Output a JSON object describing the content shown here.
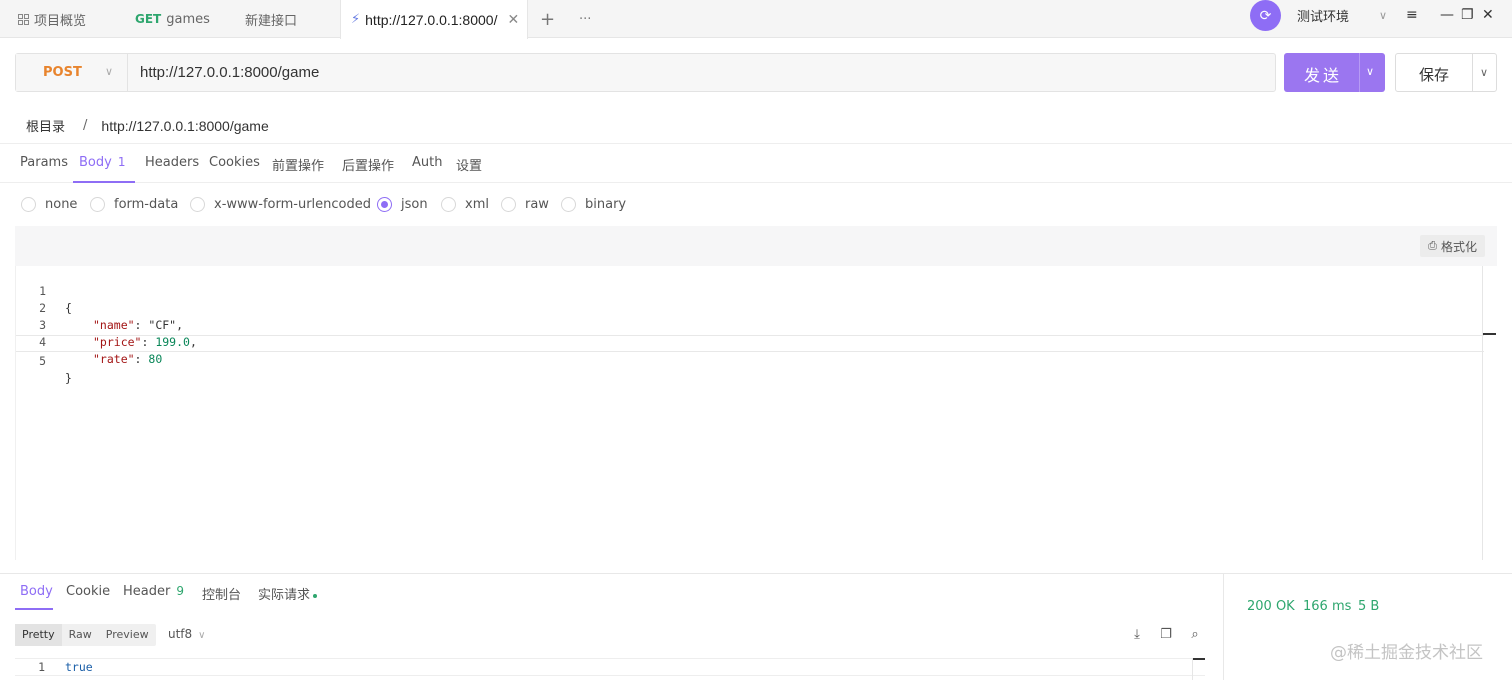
{
  "tabs": {
    "overview": "项目概览",
    "get_method": "GET",
    "get_label": "games",
    "new_api": "新建接口",
    "active_label": "http://127.0.0.1:8000/",
    "close_glyph": "✕",
    "plus_glyph": "+",
    "more_glyph": "···"
  },
  "env": {
    "name": "测试环境",
    "icon": "refresh-icon",
    "accent": "#8e6df5"
  },
  "window": {
    "menu": "≡",
    "minimize": "—",
    "restore": "❐",
    "close": "✕"
  },
  "request": {
    "method": "POST",
    "method_color": "#e8842d",
    "url": "http://127.0.0.1:8000/game",
    "send_label": "发送",
    "save_label": "保存"
  },
  "breadcrumb": {
    "root": "根目录",
    "sep": "/",
    "current": "http://127.0.0.1:8000/game"
  },
  "request_tabs": {
    "params": "Params",
    "body": "Body",
    "body_count": "1",
    "headers": "Headers",
    "cookies": "Cookies",
    "pre": "前置操作",
    "post": "后置操作",
    "auth": "Auth",
    "settings": "设置"
  },
  "body_types": {
    "none": "none",
    "form_data": "form-data",
    "urlencoded": "x-www-form-urlencoded",
    "json": "json",
    "xml": "xml",
    "raw": "raw",
    "binary": "binary",
    "selected": "json"
  },
  "editor": {
    "format_label": "格式化",
    "line_numbers": [
      "1",
      "2",
      "3",
      "4",
      "5"
    ],
    "l1": "{",
    "l2_key": "\"name\"",
    "l2_rest": ": \"CF\",",
    "l3_key": "\"price\"",
    "l3_colon": ": ",
    "l3_val": "199.0",
    "l3_comma": ",",
    "l4_key": "\"rate\"",
    "l4_colon": ": ",
    "l4_val": "80",
    "l5": "}"
  },
  "response_tabs": {
    "body": "Body",
    "cookie": "Cookie",
    "header": "Header",
    "header_count": "9",
    "console": "控制台",
    "actual": "实际请求"
  },
  "response_view": {
    "pretty": "Pretty",
    "raw": "Raw",
    "preview": "Preview",
    "encoding": "utf8",
    "line": "1",
    "content": "true"
  },
  "status": {
    "code": "200 OK",
    "time": "166 ms",
    "size": "5 B",
    "color": "#2ea66e"
  },
  "watermark": "@稀土掘金技术社区"
}
